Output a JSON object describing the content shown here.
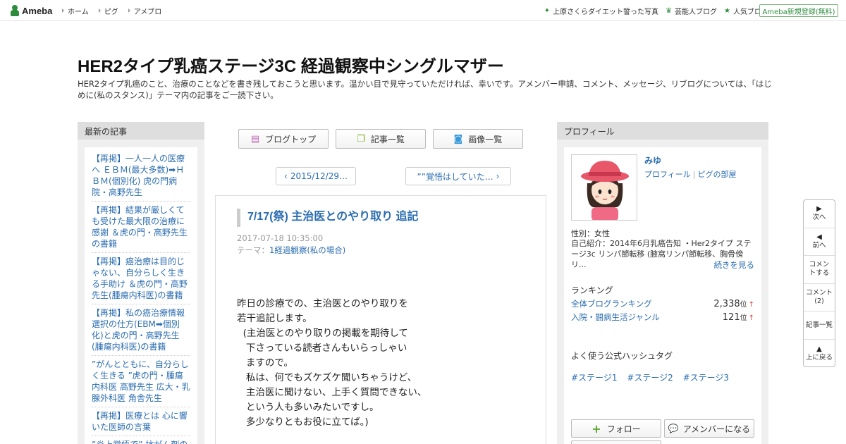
{
  "topbar": {
    "logo": "Ameba",
    "nav_left": [
      "ホーム",
      "ピグ",
      "アメブロ"
    ],
    "nav_right": [
      {
        "icon": "sparkle-icon",
        "label": "上原さくらダイエット誓った写真"
      },
      {
        "icon": "crown-icon",
        "label": "芸能人ブログ"
      },
      {
        "icon": "star-icon",
        "label": "人気ブログ"
      }
    ],
    "register": "Ameba新規登録(無料)"
  },
  "blog": {
    "title": "HER2タイプ乳癌ステージ3C 経過観察中シングルマザー",
    "description": "HER2タイプ乳癌のこと、治療のことなどを書き残しておこうと思います。温かい目で見守っていただければ、幸いです。アメンバー申請、コメント、メッセージ、リブログについては、「はじめに(私のスタンス)」テーマ内の記事をご一読下さい。"
  },
  "left": {
    "heading": "最新の記事",
    "articles": [
      "【再掲】一人一人の医療へ ＥＢＭ(最大多数)➡Ｈ ＢＭ(個別化) 虎の門病院・高野先生",
      "【再掲】結果が厳しくても受けた最大限の治療に感謝 ＆虎の門・高野先生の書籍",
      "【再掲】癌治療は目的じゃない、自分らしく生きる手助け ＆虎の門・高野先生(腫瘍内科医)の書籍",
      "【再掲】私の癌治療情報選択の仕方(EBM➡個別化)と虎の門・高野先生(腫瘍内科医)の書籍",
      "”がんとともに、自分らしく生きる ”虎の門・腫瘍内科医 高野先生 広大・乳腺外科医 角舎先生",
      "【再掲】医療とは 心に響いた医師の言葉",
      "”炎上覚悟で” 抗がん剤の"
    ]
  },
  "tabs": [
    {
      "icon": "document-icon",
      "label": "ブログトップ"
    },
    {
      "icon": "copy-icon",
      "label": "記事一覧"
    },
    {
      "icon": "camera-icon",
      "label": "画像一覧"
    }
  ],
  "pager": {
    "prev": "2015/12/29…",
    "next": "””覚悟はしていた…"
  },
  "article": {
    "title": "7/17(祭) 主治医とのやり取り 追記",
    "date": "2017-07-18 10:35:00",
    "theme_label": "テーマ：",
    "theme": "1経過観察(私の場合)",
    "body": "昨日の診療での、主治医とのやり取りを\n若干追記します。\n  (主治医とのやり取りの掲載を期待して\n   下さっている読者さんもいらっしゃい\n   ますので。\n   私は、何でもズケズケ聞いちゃうけど、\n   主治医に聞けない、上手く質問できない、\n   という人も多いみたいですし。\n   多少なりともお役に立てば。)"
  },
  "profile": {
    "heading": "プロフィール",
    "name": "みゆ",
    "link_profile": "プロフィール",
    "link_pig": "ピグの部屋",
    "gender": "性別：女性",
    "intro": "自己紹介：2014年6月乳癌告知 ・Her2タイプ ステージ3c リンパ節転移 (腋窩リンパ節転移、胸骨傍リ...",
    "more": "続きを見る",
    "ranking_heading": "ランキング",
    "rankings": [
      {
        "label": "全体ブログランキング",
        "value": "2,338",
        "unit": "位",
        "trend": "↑"
      },
      {
        "label": "入院・闘病生活ジャンル",
        "value": "121",
        "unit": "位",
        "trend": "↑"
      }
    ],
    "hashtag_heading": "よく使う公式ハッシュタグ",
    "hashtags": [
      "#ステージ1",
      "#ステージ2",
      "#ステージ3"
    ],
    "follow": "フォロー",
    "member": "アメンバーになる"
  },
  "sidenav": [
    {
      "icon": "arrow-right-icon",
      "label": "次へ"
    },
    {
      "icon": "arrow-left-icon",
      "label": "前へ"
    },
    {
      "icon": "",
      "label": "コメントする"
    },
    {
      "icon": "",
      "label": "コメント(2)"
    },
    {
      "icon": "",
      "label": "記事一覧"
    },
    {
      "icon": "arrow-up-icon",
      "label": "上に戻る"
    }
  ],
  "colors": {
    "accent_green": "#2d8c3c",
    "link_blue": "#2a6cb0",
    "avatar_hat": "#e8566a"
  }
}
